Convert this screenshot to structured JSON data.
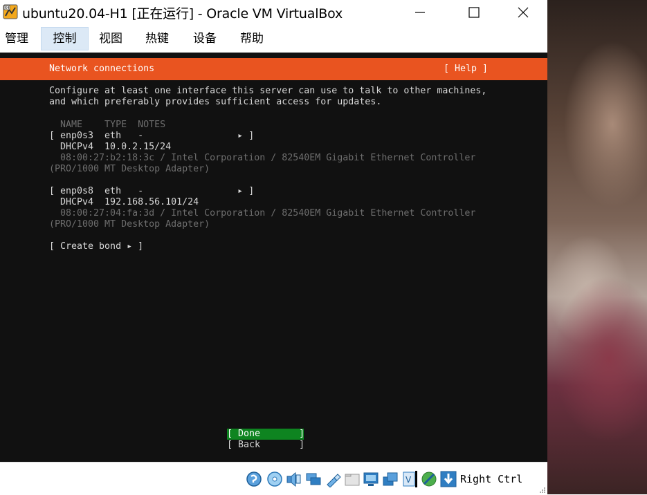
{
  "window": {
    "title": "ubuntu20.04-H1 [正在运行] - Oracle VM VirtualBox",
    "icon_letters": "64"
  },
  "menubar": {
    "items": [
      "管理",
      "控制",
      "视图",
      "热键",
      "设备",
      "帮助"
    ],
    "active": "控制"
  },
  "installer": {
    "header_title": "Network connections",
    "help_label": "[ Help ]",
    "description_line1": "Configure at least one interface this server can use to talk to other machines,",
    "description_line2": "and which preferably provides sufficient access for updates.",
    "columns_header": "  NAME    TYPE  NOTES",
    "interfaces": [
      {
        "row": "[ enp0s3  eth   -                 ▸ ]",
        "address": "  DHCPv4  10.0.2.15/24",
        "mac_info": "  08:00:27:b2:18:3c / Intel Corporation / 82540EM Gigabit Ethernet Controller",
        "model": "(PRO/1000 MT Desktop Adapter)"
      },
      {
        "row": "[ enp0s8  eth   -                 ▸ ]",
        "address": "  DHCPv4  192.168.56.101/24",
        "mac_info": "  08:00:27:04:fa:3d / Intel Corporation / 82540EM Gigabit Ethernet Controller",
        "model": "(PRO/1000 MT Desktop Adapter)"
      }
    ],
    "create_bond_label": "[ Create bond ▸ ]",
    "done_label": "[ Done       ]",
    "back_label": "[ Back       ]",
    "accent_color": "#e95420",
    "selected_color": "#0e8420"
  },
  "statusbar": {
    "icons": [
      "hard-disk-icon",
      "optical-drive-icon",
      "audio-icon",
      "network-icon",
      "usb-icon",
      "shared-folder-icon",
      "display-icon",
      "video-capture-icon",
      "cpu-icon",
      "mouse-integration-icon",
      "keyboard-icon"
    ],
    "host_key_label": "Right Ctrl"
  }
}
